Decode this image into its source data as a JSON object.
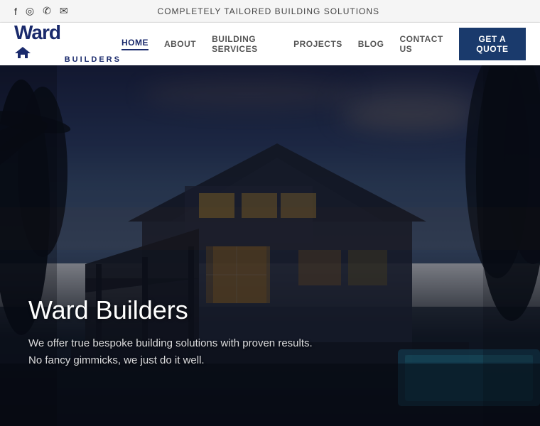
{
  "topbar": {
    "tagline": "COMPLETELY TAILORED BUILDING SOLUTIONS",
    "icons": [
      "facebook",
      "instagram",
      "phone",
      "email"
    ]
  },
  "nav": {
    "logo_word": "Ward",
    "logo_sub": "BUILDERS",
    "links": [
      {
        "label": "HOME",
        "active": true
      },
      {
        "label": "ABOUT",
        "active": false
      },
      {
        "label": "BUILDING SERVICES",
        "active": false
      },
      {
        "label": "PROJECTS",
        "active": false
      },
      {
        "label": "BLOG",
        "active": false
      },
      {
        "label": "CONTACT US",
        "active": false
      }
    ],
    "cta_label": "GET A QUOTE"
  },
  "hero": {
    "title": "Ward Builders",
    "subtitle_line1": "We offer true bespoke building solutions with proven results.",
    "subtitle_line2": "No fancy gimmicks, we just do it well."
  }
}
